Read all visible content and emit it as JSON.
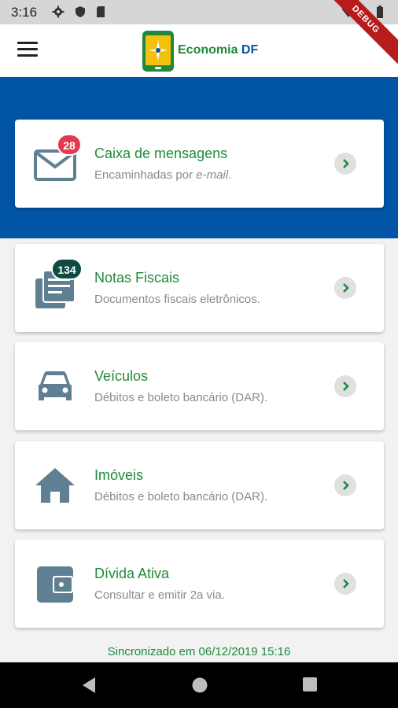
{
  "status_bar": {
    "time": "3:16",
    "icons": [
      "gear-icon",
      "shield-icon",
      "sd-card-icon",
      "wifi-icon",
      "battery-icon"
    ],
    "debug_label": "DEBUG"
  },
  "app_bar": {
    "brand_prefix": "Economia ",
    "brand_suffix": "DF",
    "menu_icon": "hamburger-menu-icon"
  },
  "cards": [
    {
      "title": "Caixa de mensagens",
      "subtitle_text": "Encaminhadas por ",
      "subtitle_italic": "e-mail",
      "subtitle_end": ".",
      "badge": "28",
      "icon": "mail-icon"
    },
    {
      "title": "Notas Fiscais",
      "subtitle": "Documentos fiscais eletrônicos.",
      "badge": "134",
      "icon": "documents-icon"
    },
    {
      "title": "Veículos",
      "subtitle": "Débitos e boleto bancário (DAR).",
      "icon": "car-icon"
    },
    {
      "title": "Imóveis",
      "subtitle": "Débitos e boleto bancário (DAR).",
      "icon": "house-icon"
    },
    {
      "title": "Dívida Ativa",
      "subtitle": "Consultar e emitir 2a via.",
      "icon": "wallet-icon"
    }
  ],
  "footer": {
    "sync_text": "Sincronizado em 06/12/2019 15:16"
  },
  "colors": {
    "primary_blue": "#0054a6",
    "accent_green": "#1f8a3b",
    "icon_gray": "#5f7f93",
    "badge_red": "#e53950",
    "badge_dark": "#0d4a41"
  }
}
